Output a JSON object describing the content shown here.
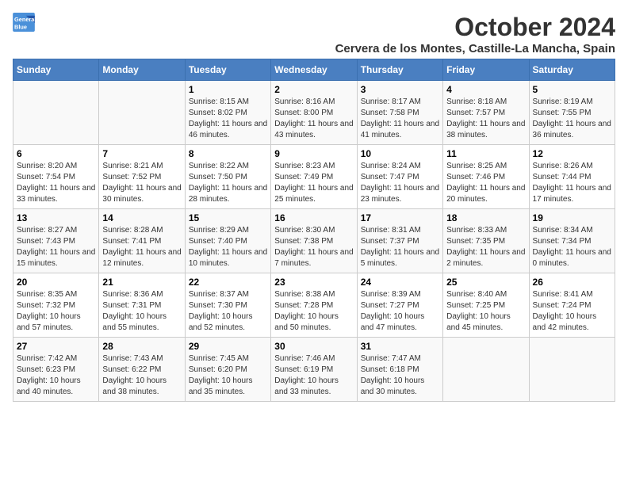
{
  "logo": {
    "line1": "General",
    "line2": "Blue"
  },
  "title": "October 2024",
  "location": "Cervera de los Montes, Castille-La Mancha, Spain",
  "weekdays": [
    "Sunday",
    "Monday",
    "Tuesday",
    "Wednesday",
    "Thursday",
    "Friday",
    "Saturday"
  ],
  "weeks": [
    [
      {
        "day": "",
        "info": ""
      },
      {
        "day": "",
        "info": ""
      },
      {
        "day": "1",
        "sunrise": "Sunrise: 8:15 AM",
        "sunset": "Sunset: 8:02 PM",
        "daylight": "Daylight: 11 hours and 46 minutes."
      },
      {
        "day": "2",
        "sunrise": "Sunrise: 8:16 AM",
        "sunset": "Sunset: 8:00 PM",
        "daylight": "Daylight: 11 hours and 43 minutes."
      },
      {
        "day": "3",
        "sunrise": "Sunrise: 8:17 AM",
        "sunset": "Sunset: 7:58 PM",
        "daylight": "Daylight: 11 hours and 41 minutes."
      },
      {
        "day": "4",
        "sunrise": "Sunrise: 8:18 AM",
        "sunset": "Sunset: 7:57 PM",
        "daylight": "Daylight: 11 hours and 38 minutes."
      },
      {
        "day": "5",
        "sunrise": "Sunrise: 8:19 AM",
        "sunset": "Sunset: 7:55 PM",
        "daylight": "Daylight: 11 hours and 36 minutes."
      }
    ],
    [
      {
        "day": "6",
        "sunrise": "Sunrise: 8:20 AM",
        "sunset": "Sunset: 7:54 PM",
        "daylight": "Daylight: 11 hours and 33 minutes."
      },
      {
        "day": "7",
        "sunrise": "Sunrise: 8:21 AM",
        "sunset": "Sunset: 7:52 PM",
        "daylight": "Daylight: 11 hours and 30 minutes."
      },
      {
        "day": "8",
        "sunrise": "Sunrise: 8:22 AM",
        "sunset": "Sunset: 7:50 PM",
        "daylight": "Daylight: 11 hours and 28 minutes."
      },
      {
        "day": "9",
        "sunrise": "Sunrise: 8:23 AM",
        "sunset": "Sunset: 7:49 PM",
        "daylight": "Daylight: 11 hours and 25 minutes."
      },
      {
        "day": "10",
        "sunrise": "Sunrise: 8:24 AM",
        "sunset": "Sunset: 7:47 PM",
        "daylight": "Daylight: 11 hours and 23 minutes."
      },
      {
        "day": "11",
        "sunrise": "Sunrise: 8:25 AM",
        "sunset": "Sunset: 7:46 PM",
        "daylight": "Daylight: 11 hours and 20 minutes."
      },
      {
        "day": "12",
        "sunrise": "Sunrise: 8:26 AM",
        "sunset": "Sunset: 7:44 PM",
        "daylight": "Daylight: 11 hours and 17 minutes."
      }
    ],
    [
      {
        "day": "13",
        "sunrise": "Sunrise: 8:27 AM",
        "sunset": "Sunset: 7:43 PM",
        "daylight": "Daylight: 11 hours and 15 minutes."
      },
      {
        "day": "14",
        "sunrise": "Sunrise: 8:28 AM",
        "sunset": "Sunset: 7:41 PM",
        "daylight": "Daylight: 11 hours and 12 minutes."
      },
      {
        "day": "15",
        "sunrise": "Sunrise: 8:29 AM",
        "sunset": "Sunset: 7:40 PM",
        "daylight": "Daylight: 11 hours and 10 minutes."
      },
      {
        "day": "16",
        "sunrise": "Sunrise: 8:30 AM",
        "sunset": "Sunset: 7:38 PM",
        "daylight": "Daylight: 11 hours and 7 minutes."
      },
      {
        "day": "17",
        "sunrise": "Sunrise: 8:31 AM",
        "sunset": "Sunset: 7:37 PM",
        "daylight": "Daylight: 11 hours and 5 minutes."
      },
      {
        "day": "18",
        "sunrise": "Sunrise: 8:33 AM",
        "sunset": "Sunset: 7:35 PM",
        "daylight": "Daylight: 11 hours and 2 minutes."
      },
      {
        "day": "19",
        "sunrise": "Sunrise: 8:34 AM",
        "sunset": "Sunset: 7:34 PM",
        "daylight": "Daylight: 11 hours and 0 minutes."
      }
    ],
    [
      {
        "day": "20",
        "sunrise": "Sunrise: 8:35 AM",
        "sunset": "Sunset: 7:32 PM",
        "daylight": "Daylight: 10 hours and 57 minutes."
      },
      {
        "day": "21",
        "sunrise": "Sunrise: 8:36 AM",
        "sunset": "Sunset: 7:31 PM",
        "daylight": "Daylight: 10 hours and 55 minutes."
      },
      {
        "day": "22",
        "sunrise": "Sunrise: 8:37 AM",
        "sunset": "Sunset: 7:30 PM",
        "daylight": "Daylight: 10 hours and 52 minutes."
      },
      {
        "day": "23",
        "sunrise": "Sunrise: 8:38 AM",
        "sunset": "Sunset: 7:28 PM",
        "daylight": "Daylight: 10 hours and 50 minutes."
      },
      {
        "day": "24",
        "sunrise": "Sunrise: 8:39 AM",
        "sunset": "Sunset: 7:27 PM",
        "daylight": "Daylight: 10 hours and 47 minutes."
      },
      {
        "day": "25",
        "sunrise": "Sunrise: 8:40 AM",
        "sunset": "Sunset: 7:25 PM",
        "daylight": "Daylight: 10 hours and 45 minutes."
      },
      {
        "day": "26",
        "sunrise": "Sunrise: 8:41 AM",
        "sunset": "Sunset: 7:24 PM",
        "daylight": "Daylight: 10 hours and 42 minutes."
      }
    ],
    [
      {
        "day": "27",
        "sunrise": "Sunrise: 7:42 AM",
        "sunset": "Sunset: 6:23 PM",
        "daylight": "Daylight: 10 hours and 40 minutes."
      },
      {
        "day": "28",
        "sunrise": "Sunrise: 7:43 AM",
        "sunset": "Sunset: 6:22 PM",
        "daylight": "Daylight: 10 hours and 38 minutes."
      },
      {
        "day": "29",
        "sunrise": "Sunrise: 7:45 AM",
        "sunset": "Sunset: 6:20 PM",
        "daylight": "Daylight: 10 hours and 35 minutes."
      },
      {
        "day": "30",
        "sunrise": "Sunrise: 7:46 AM",
        "sunset": "Sunset: 6:19 PM",
        "daylight": "Daylight: 10 hours and 33 minutes."
      },
      {
        "day": "31",
        "sunrise": "Sunrise: 7:47 AM",
        "sunset": "Sunset: 6:18 PM",
        "daylight": "Daylight: 10 hours and 30 minutes."
      },
      {
        "day": "",
        "info": ""
      },
      {
        "day": "",
        "info": ""
      }
    ]
  ]
}
